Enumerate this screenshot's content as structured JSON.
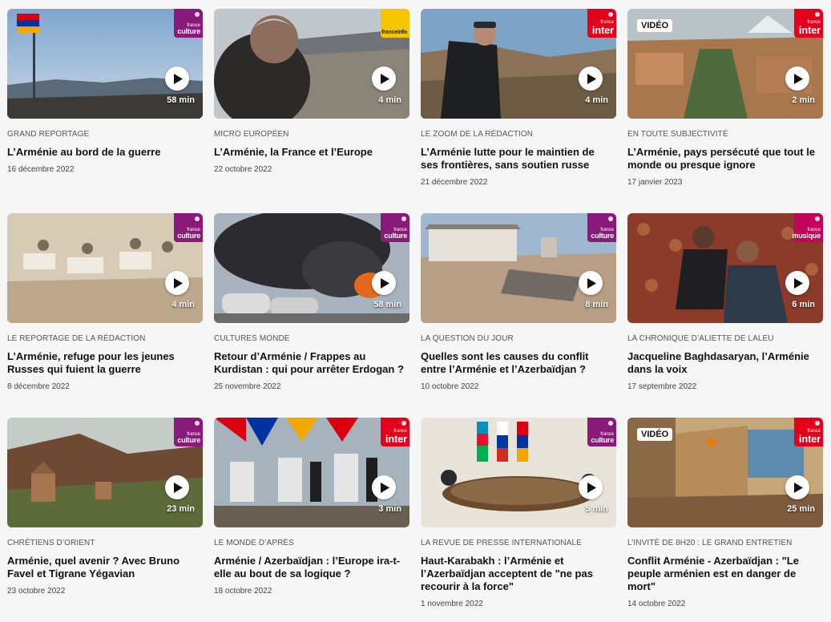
{
  "cards": [
    {
      "kicker": "GRAND REPORTAGE",
      "title": "L’Arménie au bord de la guerre",
      "date": "16 décembre 2022",
      "duration": "58 min",
      "logo": "culture",
      "logo_small": "france",
      "logo_big": "culture",
      "video": false
    },
    {
      "kicker": "MICRO EUROPÉEN",
      "title": "L’Arménie, la France et l’Europe",
      "date": "22 octobre 2022",
      "duration": "4 min",
      "logo": "info",
      "logo_small": "",
      "logo_big": "franceinfo",
      "video": false
    },
    {
      "kicker": "LE ZOOM DE LA RÉDACTION",
      "title": "L’Arménie lutte pour le maintien de ses frontières, sans soutien russe",
      "date": "21 décembre 2022",
      "duration": "4 min",
      "logo": "inter",
      "logo_small": "france",
      "logo_big": "inter",
      "video": false
    },
    {
      "kicker": "EN TOUTE SUBJECTIVITÉ",
      "title": "L’Arménie, pays persécuté que tout le monde ou presque ignore",
      "date": "17 janvier 2023",
      "duration": "2 min",
      "logo": "inter",
      "logo_small": "france",
      "logo_big": "inter",
      "video": true
    },
    {
      "kicker": "LE REPORTAGE DE LA RÉDACTION",
      "title": "L’Arménie, refuge pour les jeunes Russes qui fuient la guerre",
      "date": "8 décembre 2022",
      "duration": "4 min",
      "logo": "culture",
      "logo_small": "france",
      "logo_big": "culture",
      "video": false
    },
    {
      "kicker": "CULTURES MONDE",
      "title": "Retour d’Arménie / Frappes au Kurdistan : qui pour arrêter Erdogan ?",
      "date": "25 novembre 2022",
      "duration": "58 min",
      "logo": "culture",
      "logo_small": "france",
      "logo_big": "culture",
      "video": false
    },
    {
      "kicker": "LA QUESTION DU JOUR",
      "title": "Quelles sont les causes du conflit entre l’Arménie et l’Azerbaïdjan ?",
      "date": "10 octobre 2022",
      "duration": "8 min",
      "logo": "culture",
      "logo_small": "france",
      "logo_big": "culture",
      "video": false
    },
    {
      "kicker": "LA CHRONIQUE D’ALIETTE DE LALEU",
      "title": "Jacqueline Baghdasaryan, l’Arménie dans la voix",
      "date": "17 septembre 2022",
      "duration": "6 min",
      "logo": "musique",
      "logo_small": "france",
      "logo_big": "musique",
      "video": false
    },
    {
      "kicker": "CHRÉTIENS D’ORIENT",
      "title": "Arménie, quel avenir ? Avec Bruno Favel et Tigrane Yégavian",
      "date": "23 octobre 2022",
      "duration": "23 min",
      "logo": "culture",
      "logo_small": "france",
      "logo_big": "culture",
      "video": false
    },
    {
      "kicker": "LE MONDE D’APRÈS",
      "title": "Arménie / Azerbaïdjan : l’Europe ira-t-elle au bout de sa logique ?",
      "date": "18 octobre 2022",
      "duration": "3 min",
      "logo": "inter",
      "logo_small": "france",
      "logo_big": "inter",
      "video": false
    },
    {
      "kicker": "LA REVUE DE PRESSE INTERNATIONALE",
      "title": "Haut-Karabakh : l’Arménie et l’Azerbaïdjan acceptent de \"ne pas recourir à la force\"",
      "date": "1 novembre 2022",
      "duration": "5 min",
      "logo": "culture",
      "logo_small": "france",
      "logo_big": "culture",
      "video": false
    },
    {
      "kicker": "L’INVITÉ DE 8H20 : LE GRAND ENTRETIEN",
      "title": "Conflit Arménie - Azerbaïdjan : \"Le peuple arménien est en danger de mort\"",
      "date": "14 octobre 2022",
      "duration": "25 min",
      "logo": "inter",
      "logo_small": "france",
      "logo_big": "inter",
      "video": true
    }
  ],
  "video_label": "VIDÉO",
  "colors": {
    "culture": "#8a1a7a",
    "inter": "#e2001a",
    "musique": "#c3005a",
    "franceinfo": "#f6c500"
  }
}
